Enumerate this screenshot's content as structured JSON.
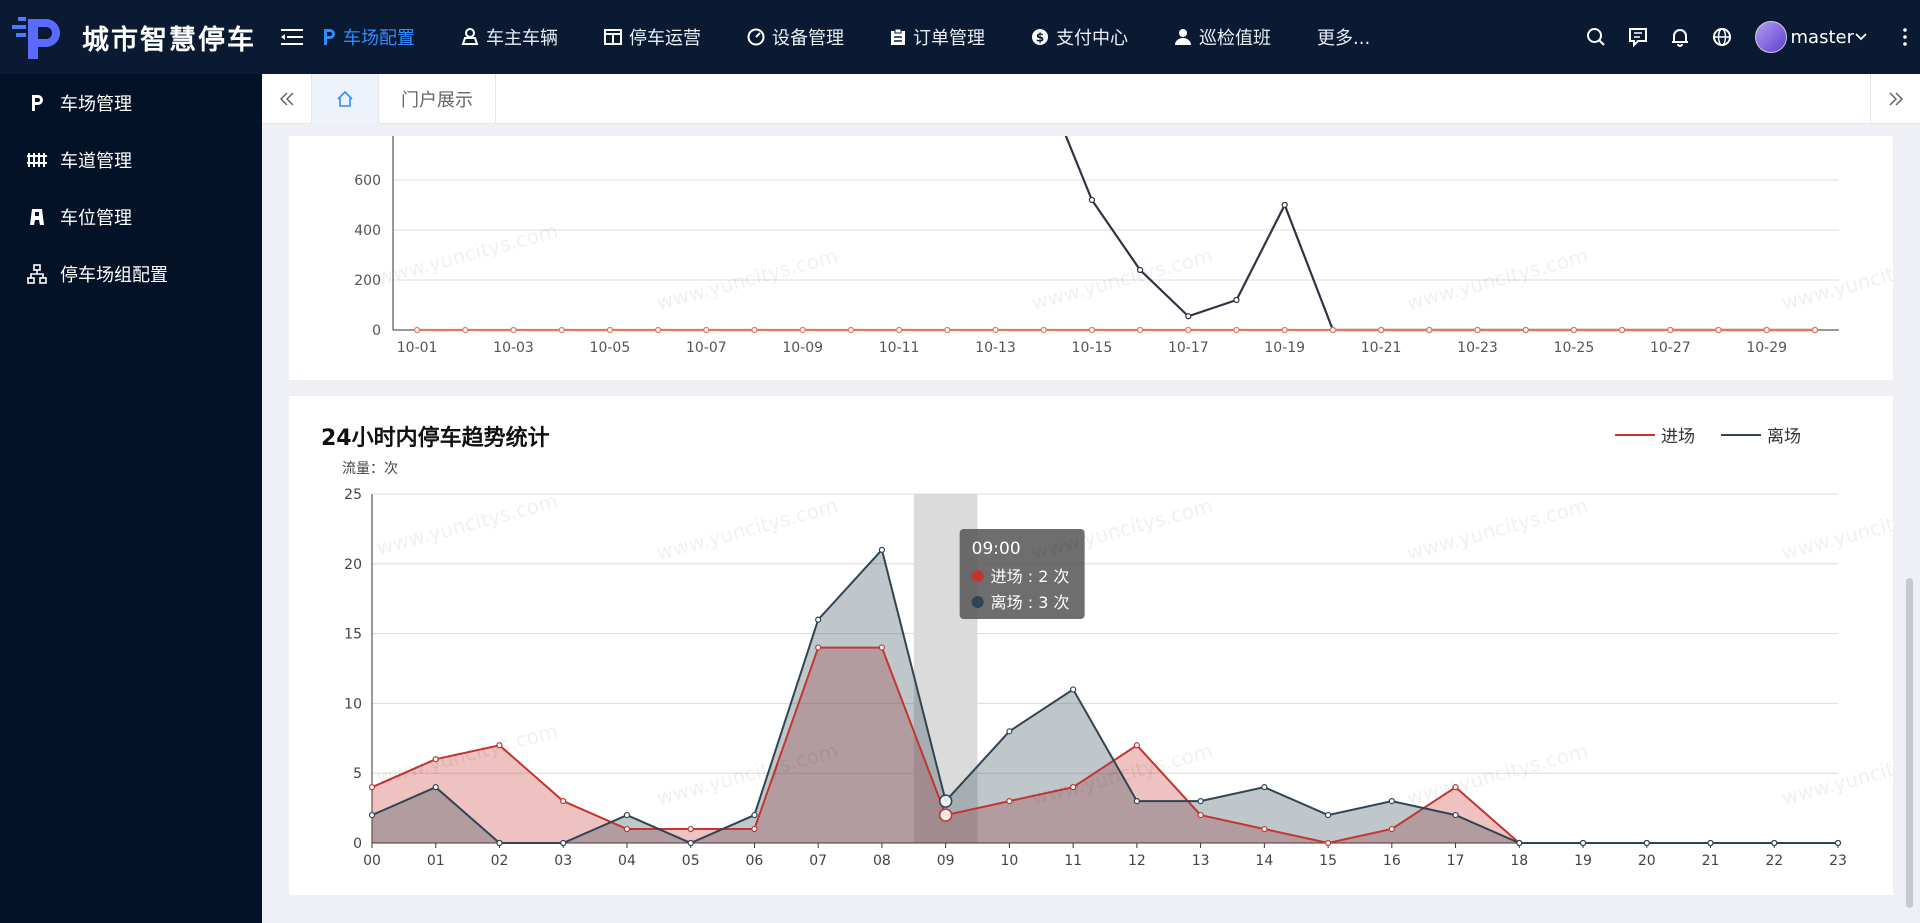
{
  "app": {
    "title": "城市智慧停车",
    "user_name": "master"
  },
  "nav": {
    "items": [
      {
        "label": "车场配置",
        "icon": "parking-p-icon",
        "active": true
      },
      {
        "label": "车主车辆",
        "icon": "car-owner-icon",
        "active": false
      },
      {
        "label": "停车运营",
        "icon": "table-icon",
        "active": false
      },
      {
        "label": "设备管理",
        "icon": "gauge-icon",
        "active": false
      },
      {
        "label": "订单管理",
        "icon": "clipboard-icon",
        "active": false
      },
      {
        "label": "支付中心",
        "icon": "dollar-icon",
        "active": false
      },
      {
        "label": "巡检值班",
        "icon": "user-icon",
        "active": false
      }
    ],
    "more_label": "更多..."
  },
  "sidebar": {
    "items": [
      {
        "label": "车场管理",
        "icon": "parking-p-icon"
      },
      {
        "label": "车道管理",
        "icon": "fence-icon"
      },
      {
        "label": "车位管理",
        "icon": "parking-space-icon"
      },
      {
        "label": "停车场组配置",
        "icon": "org-chart-icon"
      }
    ]
  },
  "tabs": {
    "items": [
      {
        "label": "门户展示"
      }
    ]
  },
  "watermark": "www.yuncitys.com",
  "chart_top": {
    "y_ticks": [
      "0",
      "200",
      "400",
      "600"
    ],
    "x_ticks": [
      "10-01",
      "10-03",
      "10-05",
      "10-07",
      "10-09",
      "10-11",
      "10-13",
      "10-15",
      "10-17",
      "10-19",
      "10-21",
      "10-23",
      "10-25",
      "10-27",
      "10-29"
    ]
  },
  "chart_bottom": {
    "title": "24小时内停车趋势统计",
    "unit": "流量：次",
    "legend": {
      "in": "进场",
      "out": "离场"
    },
    "y_ticks": [
      "0",
      "5",
      "10",
      "15",
      "20",
      "25"
    ],
    "tooltip": {
      "time": "09:00",
      "in_text": "进场 : 2 次",
      "out_text": "离场 : 3 次"
    }
  },
  "chart_data": [
    {
      "type": "line",
      "x": [
        "10-01",
        "10-02",
        "10-03",
        "10-04",
        "10-05",
        "10-06",
        "10-07",
        "10-08",
        "10-09",
        "10-10",
        "10-11",
        "10-12",
        "10-13",
        "10-14",
        "10-15",
        "10-16",
        "10-17",
        "10-18",
        "10-19",
        "10-20",
        "10-21",
        "10-22",
        "10-23",
        "10-24",
        "10-25",
        "10-26",
        "10-27",
        "10-28",
        "10-29",
        "10-30"
      ],
      "series": [
        {
          "color": "#2e3346",
          "values": [
            null,
            null,
            null,
            null,
            null,
            null,
            null,
            null,
            null,
            null,
            null,
            null,
            null,
            null,
            520,
            240,
            55,
            120,
            500,
            0,
            0,
            0,
            0,
            0,
            0,
            0,
            0,
            0,
            0,
            0
          ]
        },
        {
          "color": "#e07a5f",
          "values": [
            0,
            0,
            0,
            0,
            0,
            0,
            0,
            0,
            0,
            0,
            0,
            0,
            0,
            0,
            0,
            0,
            0,
            0,
            0,
            0,
            0,
            0,
            0,
            0,
            0,
            0,
            0,
            0,
            0,
            0
          ]
        }
      ],
      "ylim": [
        0,
        780
      ]
    },
    {
      "type": "area",
      "title": "24小时内停车趋势统计",
      "ylabel": "流量：次",
      "x": [
        "00",
        "01",
        "02",
        "03",
        "04",
        "05",
        "06",
        "07",
        "08",
        "09",
        "10",
        "11",
        "12",
        "13",
        "14",
        "15",
        "16",
        "17",
        "18",
        "19",
        "20",
        "21",
        "22",
        "23"
      ],
      "series": [
        {
          "name": "进场",
          "color": "#c23531",
          "values": [
            4,
            6,
            7,
            3,
            1,
            1,
            1,
            14,
            14,
            2,
            3,
            4,
            7,
            2,
            1,
            0,
            1,
            4,
            0,
            0,
            0,
            0,
            0,
            0
          ]
        },
        {
          "name": "离场",
          "color": "#2f4554",
          "values": [
            2,
            4,
            0,
            0,
            2,
            0,
            2,
            16,
            21,
            3,
            8,
            11,
            3,
            3,
            4,
            2,
            3,
            2,
            0,
            0,
            0,
            0,
            0,
            0
          ]
        }
      ],
      "ylim": [
        0,
        25
      ],
      "grid": true,
      "legend": "top-right",
      "highlight_x": "09"
    }
  ]
}
